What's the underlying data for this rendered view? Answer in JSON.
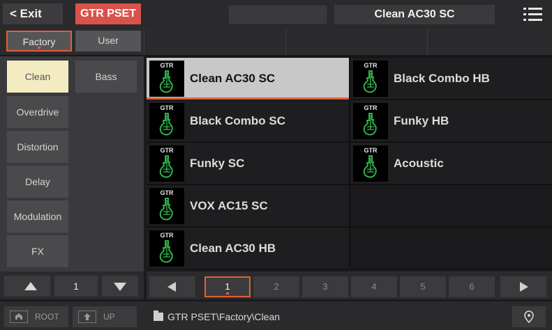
{
  "topbar": {
    "exit_label": "< Exit",
    "mode_label": "GTR PSET",
    "current_preset": "Clean AC30 SC",
    "menu_icon": "hamburger-menu-icon"
  },
  "library_tabs": [
    {
      "label": "Factory",
      "selected": true
    },
    {
      "label": "User",
      "selected": false
    }
  ],
  "categories": [
    {
      "label": "Clean",
      "selected": true
    },
    {
      "label": "Bass",
      "selected": false
    },
    {
      "label": "Overdrive",
      "selected": false
    },
    {
      "label": "Distortion",
      "selected": false
    },
    {
      "label": "Delay",
      "selected": false
    },
    {
      "label": "Modulation",
      "selected": false
    },
    {
      "label": "FX",
      "selected": false
    }
  ],
  "category_page": "1",
  "presets": [
    {
      "icon_text": "GTR",
      "name": "Clean AC30 SC",
      "selected": true
    },
    {
      "icon_text": "GTR",
      "name": "Black Combo HB",
      "selected": false
    },
    {
      "icon_text": "GTR",
      "name": "Black Combo SC",
      "selected": false
    },
    {
      "icon_text": "GTR",
      "name": "Funky HB",
      "selected": false
    },
    {
      "icon_text": "GTR",
      "name": "Funky SC",
      "selected": false
    },
    {
      "icon_text": "GTR",
      "name": "Acoustic",
      "selected": false
    },
    {
      "icon_text": "GTR",
      "name": "VOX AC15 SC",
      "selected": false
    },
    {
      "icon_text": "GTR",
      "name": "Clean AC30 HB",
      "selected": false
    }
  ],
  "pages": [
    "1",
    "2",
    "3",
    "4",
    "5",
    "6"
  ],
  "current_page": "1",
  "bottom": {
    "root_label": "ROOT",
    "up_label": "UP",
    "path": "GTR PSET\\Factory\\Clean"
  },
  "colors": {
    "accent": "#e0603a",
    "mode_badge": "#d9534a",
    "selected_category": "#f3ecc3",
    "guitar_icon": "#2fb34a"
  }
}
